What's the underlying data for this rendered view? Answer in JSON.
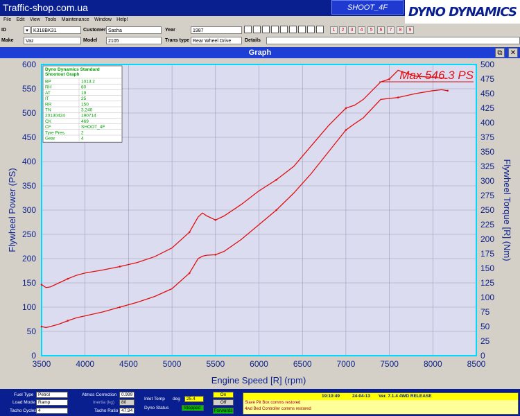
{
  "app": {
    "site_title": "Traffic-shop.com.ua",
    "shoot_label": "SHOOT_4F",
    "logo_text": "DYNO DYNAMICS"
  },
  "menu": [
    "File",
    "Edit",
    "View",
    "Tools",
    "Maintenance",
    "Window",
    "Help!"
  ],
  "vehicle": {
    "id_label": "ID",
    "id_value": "K318BK31",
    "customer_label": "Customer",
    "customer_value": "Sasha",
    "year_label": "Year",
    "year_value": "1987",
    "make_label": "Make",
    "make_value": "Vaz",
    "model_label": "Model",
    "model_value": "2105",
    "trans_label": "Trans type",
    "trans_value": "Rear Wheel Drive",
    "details_label": "Details",
    "details_value": ""
  },
  "run_buttons": [
    "1",
    "2",
    "3",
    "4",
    "5",
    "6",
    "7",
    "8",
    "9"
  ],
  "graph_window": {
    "title": "Graph",
    "restore_icon": "restore-icon",
    "close_icon": "close-icon"
  },
  "info_box": {
    "title1": "Dyno Dynamics Standard",
    "title2": "Shootout Graph",
    "rows": [
      {
        "key": "BP",
        "value": "1013.2"
      },
      {
        "key": "RH",
        "value": "80"
      },
      {
        "key": "AT",
        "value": "19"
      },
      {
        "key": "IT",
        "value": "25"
      },
      {
        "key": "RR",
        "value": "150"
      },
      {
        "key": "TN",
        "value": "3,240"
      },
      {
        "key": "20130424",
        "value": "190714"
      },
      {
        "key": "CK",
        "value": "469"
      },
      {
        "key": "CF",
        "value": "SHOOT_4F"
      },
      {
        "key": "Tyre Pres.",
        "value": "2"
      },
      {
        "key": "Gear",
        "value": "4"
      }
    ]
  },
  "chart_data": {
    "type": "line",
    "xlabel": "Engine Speed [R] (rpm)",
    "ylabel": "Flywheel Power (PS)",
    "y2label": "Flywheel Torque [R] (Nm)",
    "xlim": [
      3500,
      8500
    ],
    "ylim": [
      0,
      600
    ],
    "y2lim": [
      0,
      500
    ],
    "x_ticks": [
      3500,
      4000,
      4500,
      5000,
      5500,
      6000,
      6500,
      7000,
      7500,
      8000,
      8500
    ],
    "y_ticks": [
      0,
      50,
      100,
      150,
      200,
      250,
      300,
      350,
      400,
      450,
      500,
      550,
      600
    ],
    "y2_ticks": [
      0,
      25,
      50,
      75,
      100,
      125,
      150,
      175,
      200,
      225,
      250,
      275,
      300,
      325,
      350,
      375,
      400,
      425,
      450,
      475,
      500
    ],
    "annotation": "Max 546.3 PS",
    "grid": true,
    "line_color": "#e01010",
    "series": [
      {
        "axis": "left",
        "x": [
          3500,
          3550,
          3600,
          3700,
          3800,
          3900,
          4000,
          4200,
          4400,
          4600,
          4800,
          5000,
          5200,
          5300,
          5350,
          5400,
          5500,
          5600,
          5800,
          6000,
          6200,
          6400,
          6600,
          6800,
          7000,
          7100,
          7200,
          7400,
          7600,
          7800,
          8000,
          8100,
          8170
        ],
        "values": [
          60,
          58,
          60,
          65,
          72,
          78,
          82,
          90,
          100,
          110,
          122,
          138,
          170,
          200,
          205,
          207,
          208,
          215,
          240,
          270,
          300,
          335,
          375,
          420,
          465,
          478,
          490,
          528,
          532,
          540,
          546,
          548,
          546
        ]
      },
      {
        "axis": "right",
        "x": [
          3500,
          3550,
          3600,
          3700,
          3800,
          3900,
          4000,
          4200,
          4400,
          4600,
          4800,
          5000,
          5200,
          5300,
          5350,
          5400,
          5500,
          5600,
          5800,
          6000,
          6200,
          6400,
          6600,
          6800,
          7000,
          7100,
          7200,
          7400,
          7500,
          7600,
          7700,
          7800,
          8000,
          8170
        ],
        "values": [
          122,
          117,
          118,
          125,
          132,
          138,
          142,
          147,
          153,
          160,
          170,
          185,
          212,
          238,
          245,
          240,
          233,
          240,
          260,
          283,
          302,
          325,
          360,
          395,
          425,
          430,
          440,
          470,
          475,
          490,
          485,
          480,
          478,
          476
        ]
      }
    ]
  },
  "status": {
    "fuel_label": "Fuel Type",
    "fuel_value": "Petrol",
    "load_label": "Load Mode",
    "load_value": "Ramp",
    "tacho_label": "Tacho Cycles",
    "tacho_value": "4",
    "atmos_label": "Atmos Correction",
    "atmos_value": "0.999",
    "inertia_label": "Inertia (kg)",
    "inertia_value": "80",
    "ratio_label": "Tacho Ratio",
    "ratio_value": "47.94",
    "inlet_label": "Inlet Temp",
    "inlet_unit": "deg",
    "inlet_value": "25.4",
    "dyno_label": "Dyno Status",
    "dyno_value": "Stopped",
    "on_label": "On",
    "off_label": "Off",
    "fwd_label": "Forwards",
    "time": "19:10:49",
    "date": "24-04-13",
    "version": "Ver. 7.1.4 4WD RELEASE",
    "messages": [
      "Slave Pit Box comms restored",
      "4wd Bed Controller comms restored"
    ]
  }
}
